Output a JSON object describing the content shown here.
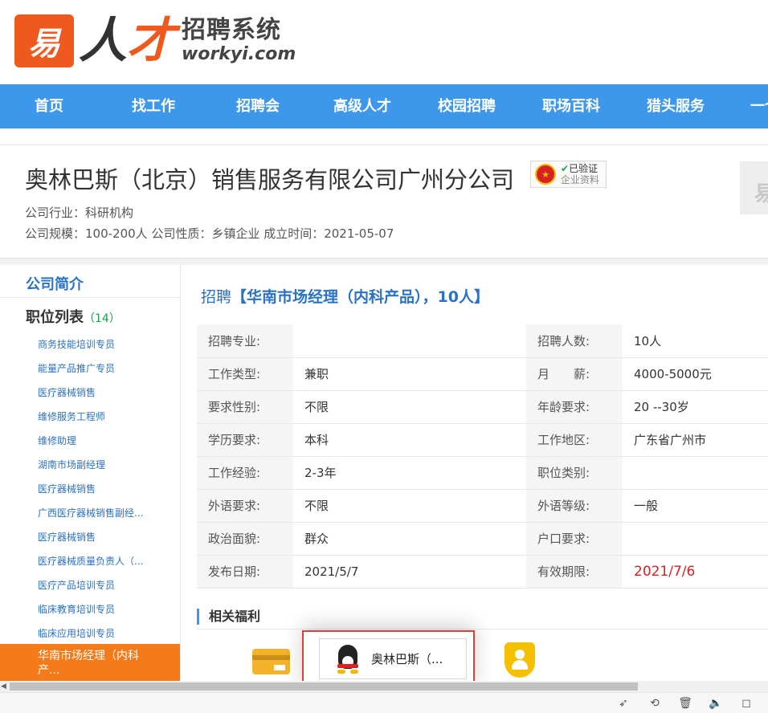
{
  "header": {
    "logo_badge": "易",
    "logo_ren": "人",
    "logo_cai": "才",
    "logo_cn": "招聘系统",
    "logo_en": "workyi.com"
  },
  "nav": {
    "items": [
      "首页",
      "找工作",
      "招聘会",
      "高级人才",
      "校园招聘",
      "职场百科",
      "猎头服务",
      "一个"
    ]
  },
  "company": {
    "name": "奥林巴斯（北京）销售服务有限公司广州分公司",
    "verify_seal": "★",
    "verify_line1": "已验证",
    "verify_check": "✔",
    "verify_line2": "企业资料",
    "industry": "公司行业：科研机构",
    "meta": "公司规模：100-200人  公司性质：乡镇企业  成立时间：2021-05-07",
    "gray_letter": "易"
  },
  "sidebar": {
    "intro": "公司简介",
    "list_title": "职位列表",
    "count": "（14）",
    "items": [
      "商务技能培训专员",
      "能量产品推广专员",
      "医疗器械销售",
      "维修服务工程师",
      "维修助理",
      "湖南市场副经理",
      "医疗器械销售",
      "广西医疗器械销售副经...",
      "医疗器械销售",
      "医疗器械质量负责人（...",
      "医疗产品培训专员",
      "临床教育培训专员",
      "临床应用培训专员"
    ],
    "active_line1": "华南市场经理（内科",
    "active_line2": "产..."
  },
  "job": {
    "prefix": "招聘",
    "title": "【华南市场经理（内科产品），10人】",
    "rows": [
      {
        "l1": "招聘专业:",
        "v1": "",
        "l2": "招聘人数:",
        "v2": "10人"
      },
      {
        "l1": "工作类型:",
        "v1": "兼职",
        "l2": "月　　薪:",
        "v2": "4000-5000元"
      },
      {
        "l1": "要求性别:",
        "v1": "不限",
        "l2": "年龄要求:",
        "v2": "20 --30岁"
      },
      {
        "l1": "学历要求:",
        "v1": "本科",
        "l2": "工作地区:",
        "v2": "广东省广州市"
      },
      {
        "l1": "工作经验:",
        "v1": "2-3年",
        "l2": "职位类别:",
        "v2": ""
      },
      {
        "l1": "外语要求:",
        "v1": "不限",
        "l2": "外语等级:",
        "v2": "一般"
      },
      {
        "l1": "政治面貌:",
        "v1": "群众",
        "l2": "户口要求:",
        "v2": ""
      },
      {
        "l1": "发布日期:",
        "v1": "2021/5/7",
        "l2": "有效期限:",
        "v2": "2021/7/6"
      }
    ],
    "benefits_title": "相关福利"
  },
  "popup": {
    "text": "奥林巴斯（..."
  },
  "scroll": {
    "left_arrow": "◀"
  },
  "statusbar": {
    "icons": [
      "rocket-icon",
      "history-icon",
      "trash-icon",
      "volume-icon",
      "window-icon"
    ],
    "glyphs": [
      "➶",
      "⟲",
      "🗑",
      "🔈",
      "◻"
    ]
  }
}
